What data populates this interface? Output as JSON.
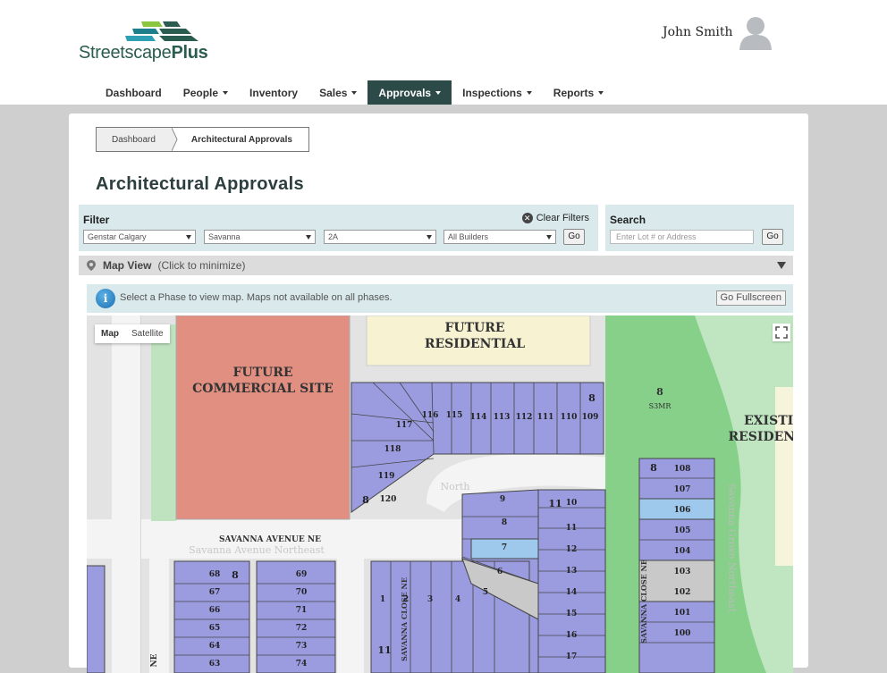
{
  "brand": {
    "name_light": "Streetscape",
    "name_bold": "Plus"
  },
  "user": {
    "name": "John Smith"
  },
  "nav": {
    "items": [
      {
        "label": "Dashboard",
        "dropdown": false,
        "active": false
      },
      {
        "label": "People",
        "dropdown": true,
        "active": false
      },
      {
        "label": "Inventory",
        "dropdown": false,
        "active": false
      },
      {
        "label": "Sales",
        "dropdown": true,
        "active": false
      },
      {
        "label": "Approvals",
        "dropdown": true,
        "active": true
      },
      {
        "label": "Inspections",
        "dropdown": true,
        "active": false
      },
      {
        "label": "Reports",
        "dropdown": true,
        "active": false
      }
    ]
  },
  "breadcrumb": {
    "home": "Dashboard",
    "current": "Architectural Approvals"
  },
  "page": {
    "title": "Architectural Approvals"
  },
  "filter": {
    "label": "Filter",
    "clear_label": "Clear Filters",
    "selects": [
      "Genstar Calgary",
      "Savanna",
      "2A",
      "All Builders"
    ],
    "go_label": "Go"
  },
  "search": {
    "label": "Search",
    "placeholder": "Enter Lot # or Address",
    "go_label": "Go"
  },
  "map_view": {
    "title": "Map View",
    "hint": "(Click to minimize)"
  },
  "info": {
    "icon_glyph": "i",
    "message": "Select a Phase to view map. Maps not available on all phases.",
    "fullscreen_label": "Go Fullscreen"
  },
  "map": {
    "type_map": "Map",
    "type_satellite": "Satellite",
    "labels": {
      "future_commercial": [
        "FUTURE",
        "COMMERCIAL SITE"
      ],
      "future_residential": [
        "FUTURE",
        "RESIDENTIAL"
      ],
      "existing_residential": [
        "EXISTIN",
        "RESIDENT"
      ],
      "park_lot": "8",
      "park_code": "S3MR",
      "avenue": "SAVANNA AVENUE NE",
      "avenue_basemap": "Savanna Avenue Northeast",
      "close_ne": "SAVANNA CLOSE NE",
      "grove_basemap": "Savanna Grove Northeast",
      "north_basemap": "North",
      "lots_top": [
        "117",
        "116",
        "115",
        "114",
        "113",
        "112",
        "111",
        "110",
        "109",
        "8",
        "118",
        "119",
        "8",
        "120"
      ],
      "lots_center": [
        "9",
        "8",
        "7",
        "6",
        "5",
        "4",
        "3",
        "2",
        "1",
        "11"
      ],
      "lots_right": [
        "11",
        "10",
        "11",
        "12",
        "13",
        "14",
        "15",
        "16",
        "17"
      ],
      "lots_far_right": [
        "108",
        "107",
        "106",
        "105",
        "104",
        "103",
        "102",
        "101",
        "100",
        "8"
      ],
      "lots_bottom_left": [
        "68",
        "67",
        "66",
        "65",
        "64",
        "63",
        "8"
      ],
      "lots_bottom_mid": [
        "69",
        "70",
        "71",
        "72",
        "73",
        "74"
      ],
      "lots_bottom_center": [
        "11"
      ],
      "street_partial": "NE"
    }
  },
  "colors": {
    "nav_active": "#2c4a47",
    "lot_fill": "#9b9ce0",
    "lot_selected": "#9ec8ec",
    "lot_grey": "#c9c9c9",
    "commercial": "#e08f81",
    "residential_future": "#f6f2d2",
    "park": "#7fcd84"
  }
}
